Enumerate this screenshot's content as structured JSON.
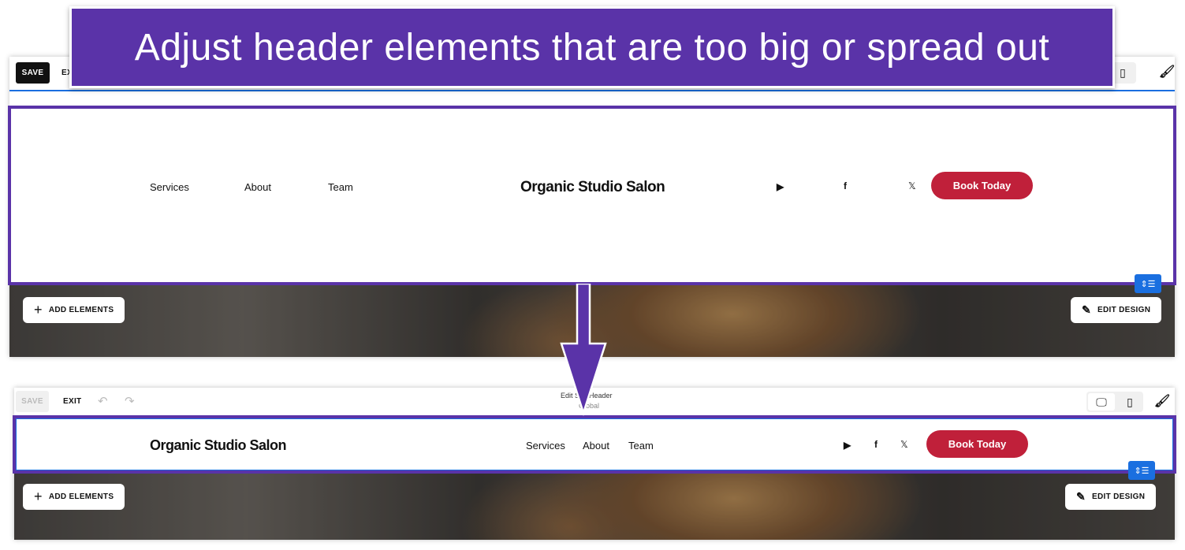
{
  "banner": {
    "text": "Adjust header elements that are too big or spread out"
  },
  "top": {
    "toolbar": {
      "save": "SAVE",
      "exit": "EXIT"
    },
    "header": {
      "nav": [
        "Services",
        "About",
        "Team"
      ],
      "logo": "Organic Studio Salon",
      "social": [
        "youtube-icon",
        "facebook-icon",
        "x-icon"
      ],
      "x_glyph": "𝕏",
      "book": "Book Today"
    },
    "add_elements": "ADD ELEMENTS",
    "edit_design": "EDIT DESIGN"
  },
  "bottom": {
    "toolbar": {
      "save": "SAVE",
      "exit": "EXIT",
      "title": "Edit Site Header",
      "subtitle": "Global"
    },
    "header": {
      "logo": "Organic Studio Salon",
      "nav": [
        "Services",
        "About",
        "Team"
      ],
      "x_glyph": "𝕏",
      "book": "Book Today"
    },
    "add_elements": "ADD ELEMENTS",
    "edit_design": "EDIT DESIGN"
  },
  "colors": {
    "accent": "#5a33a8",
    "book": "#c0203a",
    "selection": "#1a6fe0"
  }
}
